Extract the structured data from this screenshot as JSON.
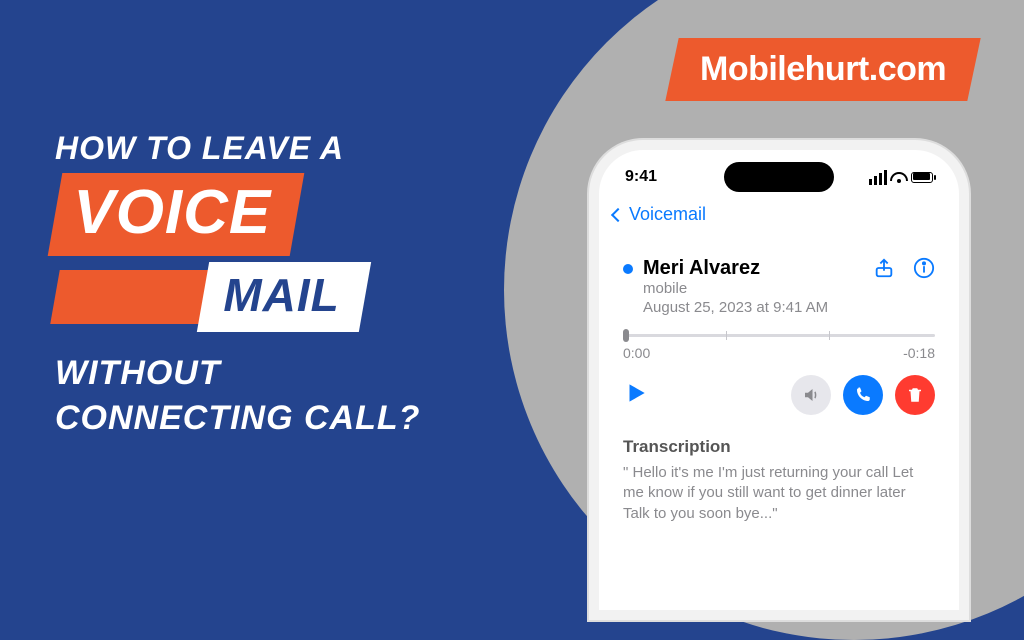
{
  "brand": "Mobilehurt.com",
  "headline": {
    "line1": "How to leave a",
    "voice": "Voice",
    "mail": "Mail",
    "line4": "without",
    "line5": "connecting call?"
  },
  "phone": {
    "time": "9:41",
    "back_label": "Voicemail",
    "voicemail": {
      "caller": "Meri Alvarez",
      "source": "mobile",
      "date": "August 25, 2023 at 9:41 AM",
      "elapsed": "0:00",
      "remaining": "-0:18"
    },
    "transcription": {
      "title": "Transcription",
      "body": "\" Hello it's me I'm just returning your call Let me know if you still want to get dinner later Talk to you soon bye...\""
    }
  }
}
